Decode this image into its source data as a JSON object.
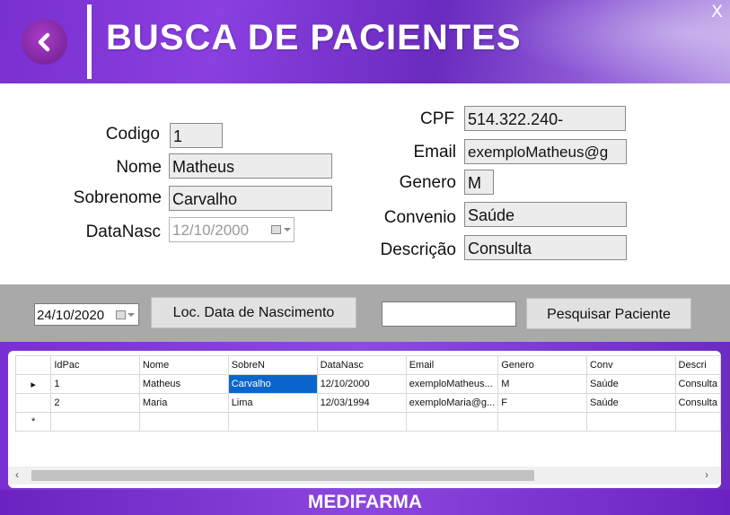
{
  "header": {
    "title": "BUSCA DE PACIENTES",
    "close_label": "X"
  },
  "form": {
    "codigo": {
      "label": "Codigo",
      "value": "1"
    },
    "nome": {
      "label": "Nome",
      "value": "Matheus"
    },
    "sobrenome": {
      "label": "Sobrenome",
      "value": "Carvalho"
    },
    "datanasc": {
      "label": "DataNasc",
      "value": "12/10/2000"
    },
    "cpf": {
      "label": "CPF",
      "value": "514.322.240-"
    },
    "email": {
      "label": "Email",
      "value": "exemploMatheus@g"
    },
    "genero": {
      "label": "Genero",
      "value": "M"
    },
    "convenio": {
      "label": "Convenio",
      "value": "Saúde"
    },
    "descricao": {
      "label": "Descrição",
      "value": "Consulta"
    }
  },
  "toolbar": {
    "date_value": "24/10/2020",
    "loc_button": "Loc. Data de Nascimento",
    "search_value": "",
    "search_button": "Pesquisar Paciente"
  },
  "grid": {
    "columns": [
      "IdPac",
      "Nome",
      "SobreN",
      "DataNasc",
      "Email",
      "Genero",
      "Conv",
      "Descri"
    ],
    "rows": [
      [
        "1",
        "Matheus",
        "Carvalho",
        "12/10/2000",
        "exemploMatheus...",
        "M",
        "Saúde",
        "Consulta"
      ],
      [
        "2",
        "Maria",
        "Lima",
        "12/03/1994",
        "exemploMaria@g...",
        "F",
        "Saúde",
        "Consulta"
      ]
    ],
    "current_row_marker": "▸",
    "new_row_marker": "*"
  },
  "footer": {
    "brand": "MEDIFARMA"
  },
  "colors": {
    "accent": "#7a2fd0",
    "selection": "#0a66cc",
    "toolbar": "#a9a9a9"
  }
}
